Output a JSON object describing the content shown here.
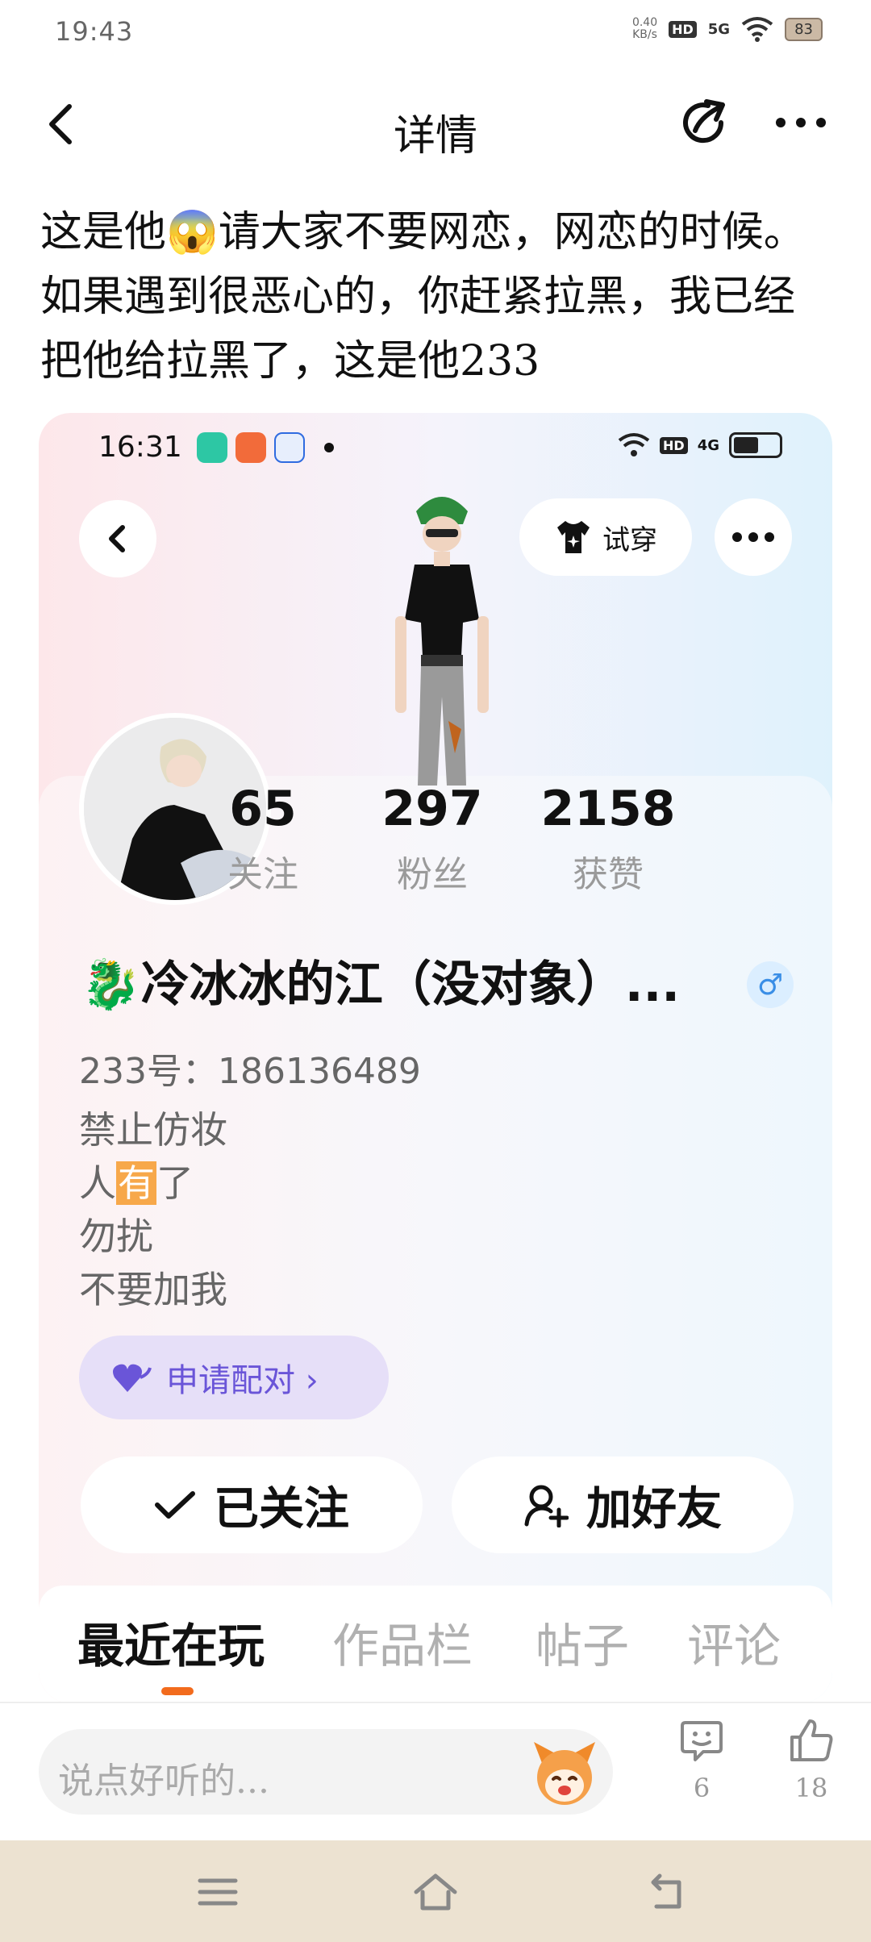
{
  "status_bar": {
    "time": "19:43",
    "speed_value": "0.40",
    "speed_unit": "KB/s",
    "hd": "HD",
    "network": "5G",
    "battery": "83"
  },
  "nav": {
    "title": "详情"
  },
  "post": {
    "text_part1": "这是他",
    "emoji": "😱",
    "text_part2": "请大家不要网恋，网恋的时候。如果遇到很恶心的，你赶紧拉黑，我已经把他给拉黑了，这是他233"
  },
  "card": {
    "status": {
      "time": "16:31",
      "hd": "HD",
      "network": "4G"
    },
    "try_on_label": "试穿",
    "stats": [
      {
        "num": "65",
        "label": "关注"
      },
      {
        "num": "297",
        "label": "粉丝"
      },
      {
        "num": "2158",
        "label": "获赞"
      }
    ],
    "nickname": "🐉冷冰冰的江（没对象）...",
    "gender_symbol": "♂",
    "uid": "233号：186136489",
    "bio": {
      "line1": "禁止仿妆",
      "line2_pre": "人",
      "line2_hl": "有",
      "line2_post": "了",
      "line3": "勿扰",
      "line4": "不要加我"
    },
    "pair_label": "申请配对 ›",
    "follow_label": "已关注",
    "add_friend_label": "加好友",
    "tabs": [
      "最近在玩",
      "作品栏",
      "帖子",
      "评论"
    ],
    "active_tab": 0
  },
  "bottom_bar": {
    "comment_placeholder": "说点好听的...",
    "comment_count": "6",
    "like_count": "18"
  }
}
